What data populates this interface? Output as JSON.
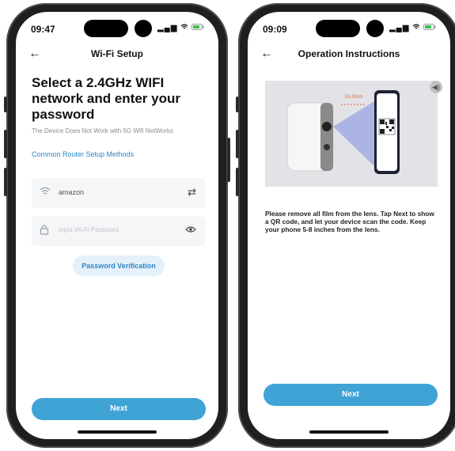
{
  "left_screen": {
    "status": {
      "time": "09:47",
      "signal": "ıl",
      "wifi": "wifi-icon",
      "battery": "battery-icon"
    },
    "nav": {
      "back": "←",
      "title": "Wi-Fi Setup"
    },
    "headline": "Select a 2.4GHz WIFI network and enter your password",
    "subnote": "The Device Does Not Work with 5G Wifi NetWorks",
    "link": "Common Router Setup Methods",
    "wifi_field": {
      "value": "amazon",
      "icon": "wifi-icon",
      "action_icon": "switch-icon"
    },
    "password_field": {
      "placeholder": "Input Wi-Fi Password",
      "icon": "lock-icon",
      "action_icon": "eye-icon"
    },
    "verify_button": "Password Verification",
    "next_button": "Next"
  },
  "right_screen": {
    "status": {
      "time": "09:09",
      "signal": "ıl",
      "wifi": "wifi-icon",
      "battery": "battery-icon"
    },
    "nav": {
      "back": "←",
      "title": "Operation Instructions"
    },
    "distance_label": "15-20cm",
    "instructions": "Please remove all film from the lens. Tap Next to show a QR code, and let your device scan the code. Keep your phone 5-8 inches from the lens.",
    "next_button": "Next"
  }
}
